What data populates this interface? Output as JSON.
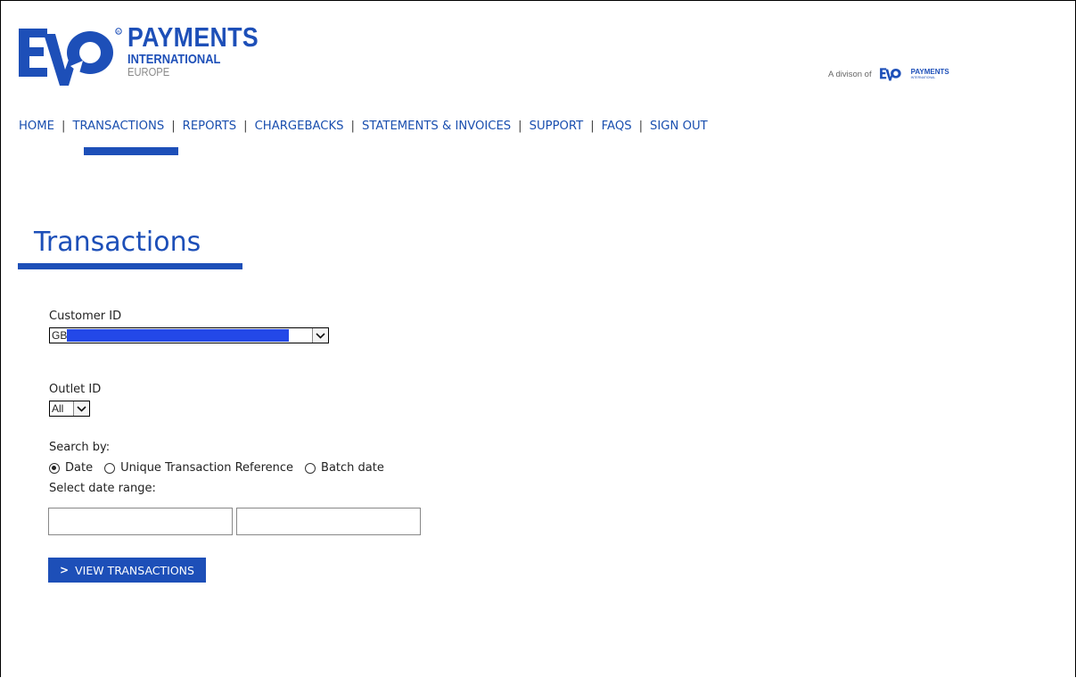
{
  "brand": {
    "logo_letters": "EVO",
    "logo_line1": "PAYMENTS",
    "logo_line2": "INTERNATIONAL",
    "logo_line3": "EUROPE",
    "division_text": "A divison of",
    "division_logo_line1": "PAYMENTS",
    "division_logo_line2": "INTERNATIONAL",
    "primary_color": "#1d4fb8"
  },
  "nav": {
    "items": [
      "HOME",
      "TRANSACTIONS",
      "REPORTS",
      "CHARGEBACKS",
      "STATEMENTS & INVOICES",
      "SUPPORT",
      "FAQS",
      "SIGN OUT"
    ],
    "separator": "|",
    "active": "TRANSACTIONS"
  },
  "page": {
    "title": "Transactions"
  },
  "form": {
    "customer_id_label": "Customer ID",
    "customer_id_value": "GB",
    "outlet_id_label": "Outlet ID",
    "outlet_id_value": "All",
    "search_by_label": "Search by:",
    "search_options": [
      "Date",
      "Unique Transaction Reference",
      "Batch date"
    ],
    "search_selected": "Date",
    "date_range_label": "Select date range:",
    "date_from_value": "",
    "date_to_value": "",
    "submit_arrow": ">",
    "submit_label": "VIEW TRANSACTIONS"
  }
}
